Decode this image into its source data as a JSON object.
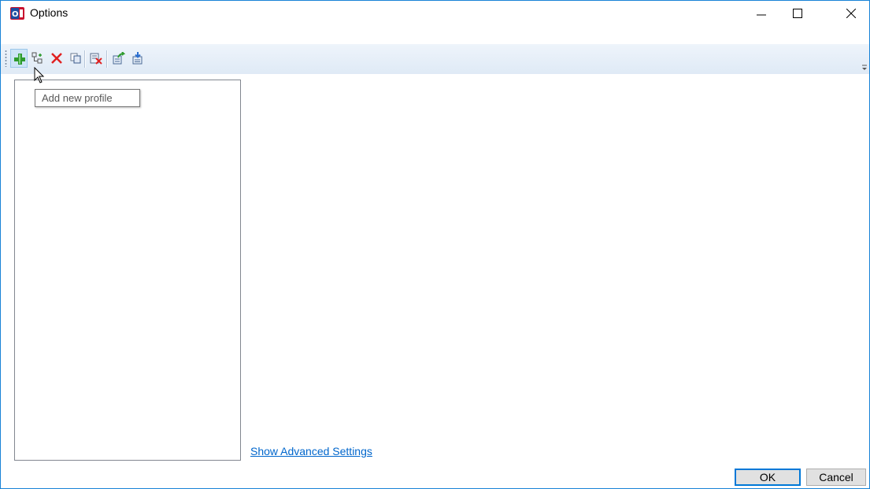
{
  "window": {
    "title": "Options",
    "app_icon": "options-app-icon",
    "controls": [
      "minimize-icon",
      "maximize-icon",
      "close-icon"
    ]
  },
  "toolbar": {
    "buttons": [
      {
        "name": "add-new-profile",
        "icon": "green-plus-icon"
      },
      {
        "name": "add-child",
        "icon": "tree-add-icon"
      },
      {
        "name": "delete",
        "icon": "red-x-icon"
      },
      {
        "name": "copy",
        "icon": "copy-icon"
      },
      {
        "name": "clear",
        "icon": "clear-list-icon"
      },
      {
        "name": "export",
        "icon": "export-icon"
      },
      {
        "name": "import",
        "icon": "import-icon"
      }
    ]
  },
  "tooltip": {
    "text": "Add new profile"
  },
  "profile_list": {
    "items": []
  },
  "links": {
    "advanced": "Show Advanced Settings"
  },
  "buttons": {
    "ok": "OK",
    "cancel": "Cancel"
  },
  "colors": {
    "accent": "#0078d7",
    "link": "#0066cc",
    "toolbar": "#dfeaf6"
  }
}
